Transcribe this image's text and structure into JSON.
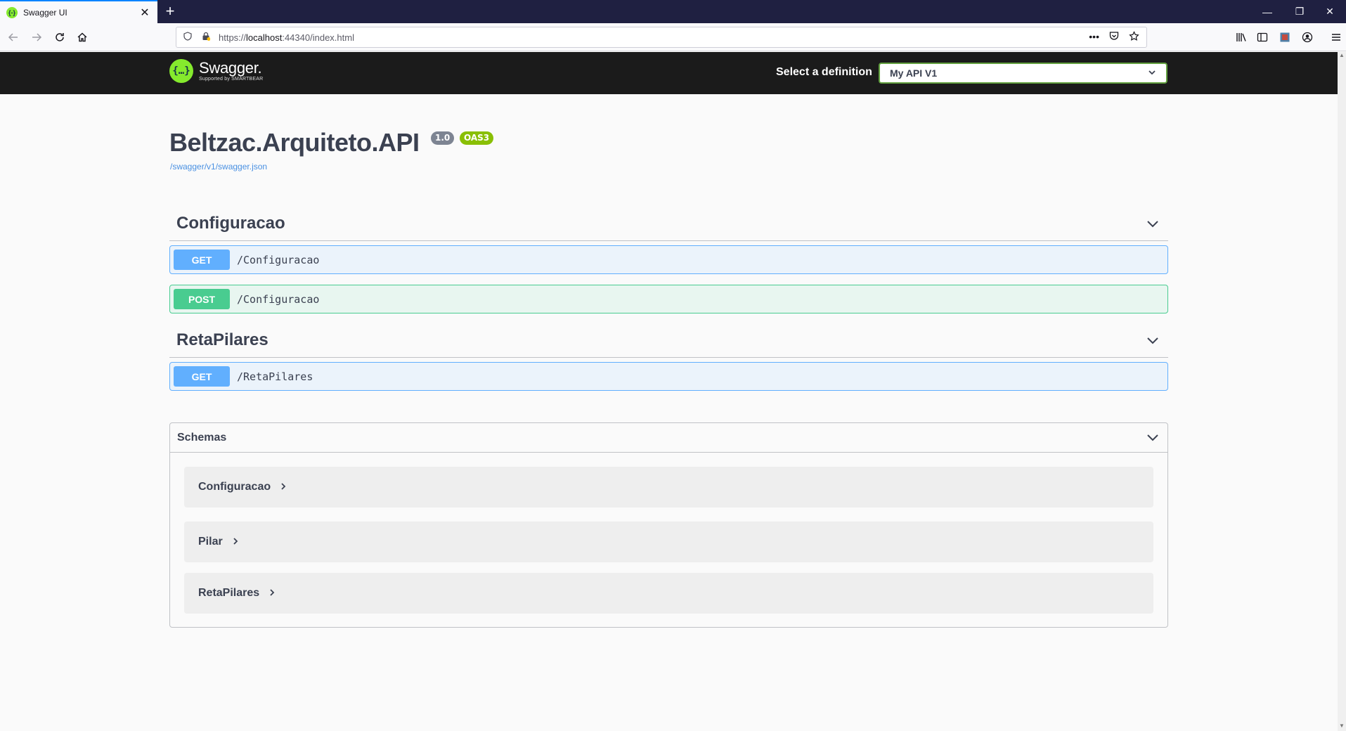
{
  "browser": {
    "tab_title": "Swagger UI",
    "tab_favicon": "{-}",
    "close_tab": "✕",
    "new_tab": "+",
    "url_prefix": "https://",
    "url_host": "localhost",
    "url_rest": ":44340/index.html",
    "window_controls": {
      "minimize": "—",
      "restore": "❐",
      "close": "✕"
    }
  },
  "topbar": {
    "logo_mark": "{…}",
    "logo_name": "Swagger.",
    "logo_sub": "Supported by SMARTBEAR",
    "definition_label": "Select a definition",
    "definition_value": "My API V1"
  },
  "info": {
    "title": "Beltzac.Arquiteto.API",
    "version": "1.0",
    "oas": "OAS3",
    "spec_url": "/swagger/v1/swagger.json"
  },
  "tags": [
    {
      "name": "Configuracao",
      "operations": [
        {
          "method": "GET",
          "path": "/Configuracao"
        },
        {
          "method": "POST",
          "path": "/Configuracao"
        }
      ]
    },
    {
      "name": "RetaPilares",
      "operations": [
        {
          "method": "GET",
          "path": "/RetaPilares"
        }
      ]
    }
  ],
  "schemas": {
    "title": "Schemas",
    "models": [
      "Configuracao",
      "Pilar",
      "RetaPilares"
    ]
  },
  "colors": {
    "get": "#61affe",
    "post": "#49cc90",
    "swagger_green": "#85ea2d",
    "text": "#3b4151"
  }
}
